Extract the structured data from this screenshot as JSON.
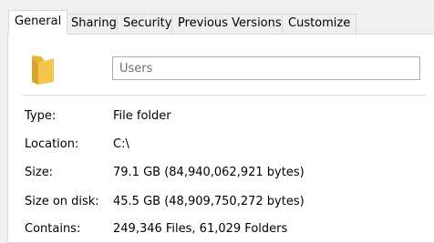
{
  "tabs": [
    {
      "label": "General",
      "active": true
    },
    {
      "label": "Sharing",
      "active": false
    },
    {
      "label": "Security",
      "active": false
    },
    {
      "label": "Previous Versions",
      "active": false
    },
    {
      "label": "Customize",
      "active": false
    }
  ],
  "general": {
    "folder_icon": "folder-icon",
    "name_value": "Users",
    "properties": [
      {
        "label": "Type:",
        "value": "File folder"
      },
      {
        "label": "Location:",
        "value": "C:\\"
      },
      {
        "label": "Size:",
        "value": "79.1 GB (84,940,062,921 bytes)"
      },
      {
        "label": "Size on disk:",
        "value": "45.5 GB (48,909,750,272 bytes)"
      },
      {
        "label": "Contains:",
        "value": "249,346 Files, 61,029 Folders"
      }
    ]
  },
  "colors": {
    "folder": "#f3c74b",
    "panel_bg": "#ffffff",
    "window_bg": "#f0f0f0",
    "border": "#d9d9d9"
  }
}
